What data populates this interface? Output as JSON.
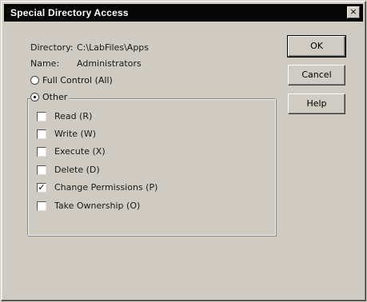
{
  "window": {
    "title": "Special Directory Access",
    "close_label": "×"
  },
  "info": {
    "directory_label": "Directory:",
    "directory_value": "C:\\LabFiles\\Apps",
    "name_label": "Name:",
    "name_value": "Administrators"
  },
  "access": {
    "full_control_label": "Full Control (All)",
    "other_label": "Other",
    "selected": "other"
  },
  "permissions": [
    {
      "label": "Read (R)",
      "checked": false
    },
    {
      "label": "Write (W)",
      "checked": false
    },
    {
      "label": "Execute (X)",
      "checked": false
    },
    {
      "label": "Delete (D)",
      "checked": false
    },
    {
      "label": "Change Permissions (P)",
      "checked": true
    },
    {
      "label": "Take Ownership (O)",
      "checked": false
    }
  ],
  "buttons": {
    "ok": "OK",
    "cancel": "Cancel",
    "help": "Help"
  }
}
